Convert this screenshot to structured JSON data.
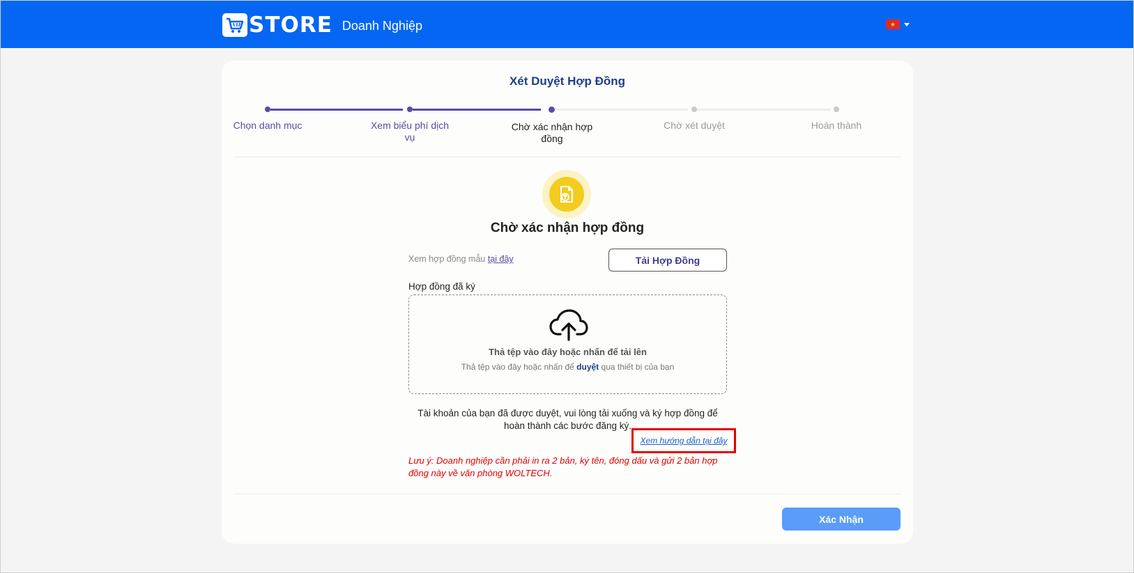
{
  "header": {
    "logo_text": "STORE",
    "logo_subtitle": "Doanh Nghiệp",
    "language_flag": "vietnam-flag"
  },
  "card": {
    "title": "Xét Duyệt Hợp Đồng",
    "steps": [
      {
        "label_line1": "Chọn danh mục",
        "label_line2": "",
        "state": "done"
      },
      {
        "label_line1": "Xem biểu phí dịch",
        "label_line2": "vụ",
        "state": "done"
      },
      {
        "label_line1": "Chờ xác nhận hợp",
        "label_line2": "đồng",
        "state": "current"
      },
      {
        "label_line1": "Chờ xét duyệt",
        "label_line2": "",
        "state": "pending"
      },
      {
        "label_line1": "Hoàn thành",
        "label_line2": "",
        "state": "pending"
      }
    ],
    "status_title": "Chờ xác nhận hợp đồng",
    "sample_prefix": "Xem hợp đồng mẫu",
    "sample_link": "tại đây",
    "download_button": "Tải Hợp Đồng",
    "signed_label": "Hợp đồng đã ký",
    "dropzone": {
      "main_text": "Thả tệp vào đây hoặc nhấn để tải lên",
      "sub_prefix": "Thả tệp vào đây hoặc nhấn để",
      "sub_link": "duyệt",
      "sub_suffix": "qua thiết bị của bạn"
    },
    "approved_message": "Tài khoản của bạn đã được duyệt, vui lòng tải xuống và ký hợp đồng để hoàn thành các bước đăng ký.",
    "guide_link": "Xem hướng dẫn tại đây",
    "note": "Lưu ý: Doanh nghiệp cần phải in ra 2 bản, ký tên, đóng dấu và gửi 2 bản hợp đồng này về văn phòng WOLTECH.",
    "confirm_button": "Xác Nhận"
  },
  "colors": {
    "header_bg": "#0466f3",
    "step_active": "#5b4aa6",
    "step_inactive": "#c9c9c9",
    "accent_yellow": "#f3cc1f",
    "note_red": "#e00000",
    "highlight_border": "#e50000",
    "confirm_bg": "#5a9cf7"
  }
}
